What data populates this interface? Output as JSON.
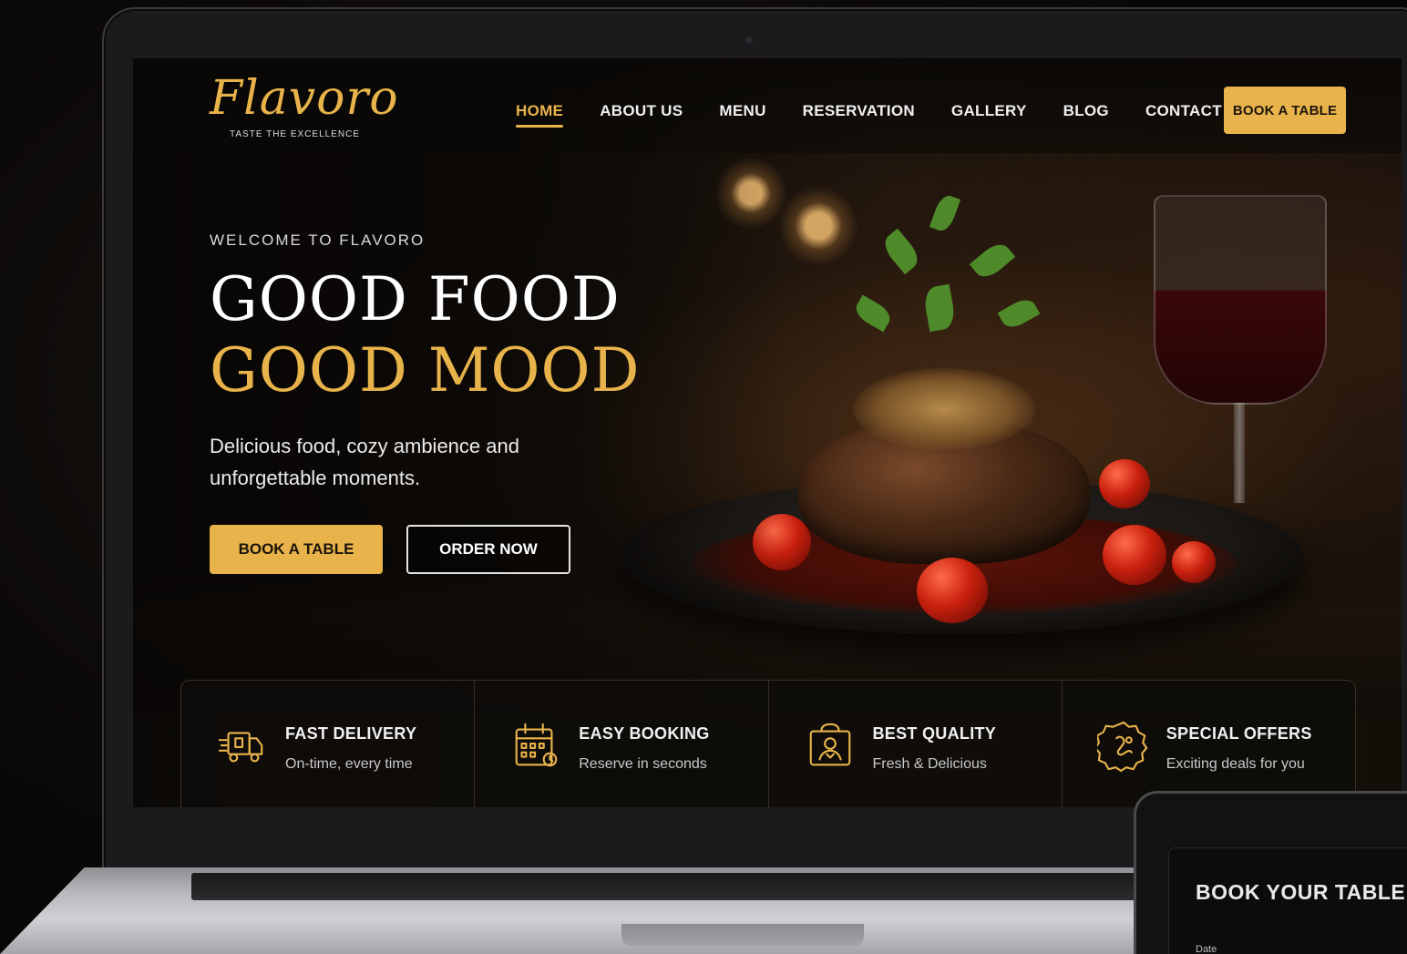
{
  "brand": {
    "name": "Flavoro",
    "tagline": "TASTE THE EXCELLENCE",
    "accent": "#e8b34a"
  },
  "nav": {
    "items": [
      {
        "label": "HOME",
        "active": true
      },
      {
        "label": "ABOUT US",
        "active": false
      },
      {
        "label": "MENU",
        "active": false
      },
      {
        "label": "RESERVATION",
        "active": false
      },
      {
        "label": "GALLERY",
        "active": false
      },
      {
        "label": "BLOG",
        "active": false
      },
      {
        "label": "CONTACT",
        "active": false
      }
    ],
    "cta": "BOOK A TABLE"
  },
  "hero": {
    "eyebrow": "WELCOME TO FLAVORO",
    "headline_line1": "GOOD FOOD",
    "headline_line2": "GOOD MOOD",
    "subtitle": "Delicious food, cozy ambience and unforgettable moments.",
    "primary_button": "BOOK A TABLE",
    "secondary_button": "ORDER NOW"
  },
  "features": [
    {
      "icon": "delivery-truck-icon",
      "title": "FAST DELIVERY",
      "desc": "On-time, every time"
    },
    {
      "icon": "calendar-icon",
      "title": "EASY BOOKING",
      "desc": "Reserve in seconds"
    },
    {
      "icon": "chef-quality-icon",
      "title": "BEST QUALITY",
      "desc": "Fresh & Delicious"
    },
    {
      "icon": "offer-badge-icon",
      "title": "SPECIAL OFFERS",
      "desc": "Exciting deals for you"
    }
  ],
  "device": {
    "title": "BOOK YOUR TABLE",
    "field_label": "Date"
  }
}
